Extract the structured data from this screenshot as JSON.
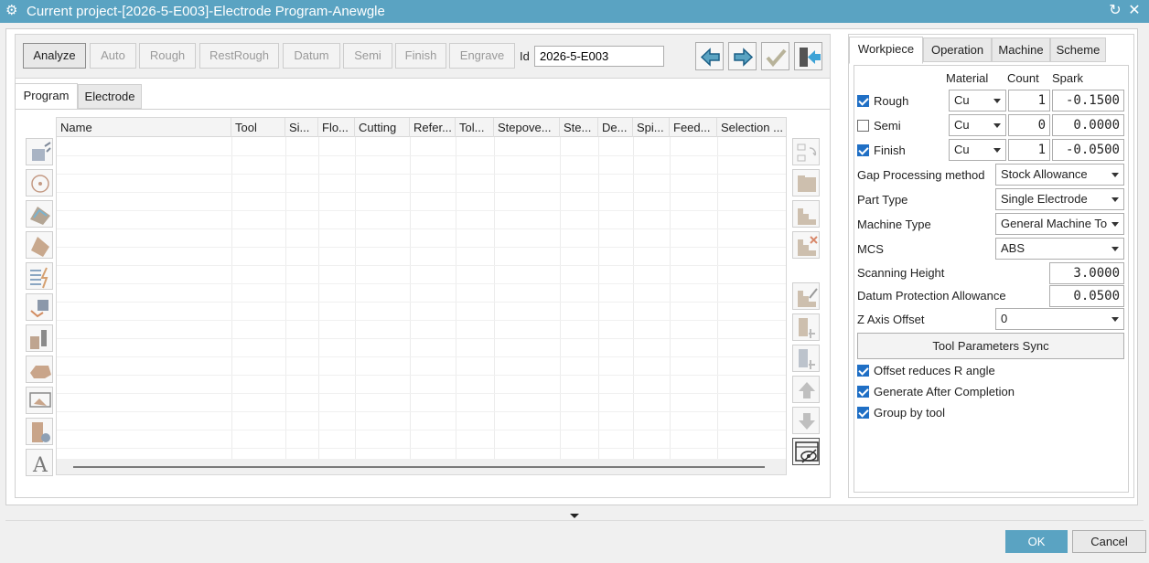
{
  "window": {
    "title": "Current project-[2026-5-E003]-Electrode Program-Anewgle",
    "gear_glyph": "⚙",
    "refresh_glyph": "↻",
    "close_glyph": "✕"
  },
  "toolbar": {
    "buttons": [
      {
        "label": "Analyze",
        "enabled": true
      },
      {
        "label": "Auto",
        "enabled": false
      },
      {
        "label": "Rough",
        "enabled": false
      },
      {
        "label": "RestRough",
        "enabled": false
      },
      {
        "label": "Datum",
        "enabled": false
      },
      {
        "label": "Semi",
        "enabled": false
      },
      {
        "label": "Finish",
        "enabled": false
      },
      {
        "label": "Engrave",
        "enabled": false
      }
    ],
    "id_label": "Id",
    "id_value": "2026-5-E003"
  },
  "left_tabs": [
    "Program",
    "Electrode"
  ],
  "table": {
    "columns": [
      "Name",
      "Tool",
      "Si...",
      "Flo...",
      "Cutting",
      "Refer...",
      "Tol...",
      "Stepove...",
      "Ste...",
      "De...",
      "Spi...",
      "Feed...",
      "Selection ..."
    ]
  },
  "right_tabs": [
    "Workpiece",
    "Operation",
    "Machine",
    "Scheme"
  ],
  "workpiece": {
    "headers": {
      "material": "Material",
      "count": "Count",
      "spark": "Spark"
    },
    "rows": [
      {
        "label": "Rough",
        "checked": true,
        "material": "Cu",
        "count": "1",
        "spark": "-0.1500"
      },
      {
        "label": "Semi",
        "checked": false,
        "material": "Cu",
        "count": "0",
        "spark": "0.0000"
      },
      {
        "label": "Finish",
        "checked": true,
        "material": "Cu",
        "count": "1",
        "spark": "-0.0500"
      }
    ],
    "gap_processing_label": "Gap Processing method",
    "gap_processing_value": "Stock Allowance",
    "part_type_label": "Part Type",
    "part_type_value": "Single Electrode",
    "machine_type_label": "Machine Type",
    "machine_type_value": "General Machine To",
    "mcs_label": "MCS",
    "mcs_value": "ABS",
    "scanning_height_label": "Scanning Height",
    "scanning_height_value": "3.0000",
    "datum_protection_label": "Datum Protection Allowance",
    "datum_protection_value": "0.0500",
    "z_offset_label": "Z Axis Offset",
    "z_offset_value": "0",
    "sync_button": "Tool Parameters Sync",
    "options": [
      {
        "label": "Offset reduces R angle",
        "checked": true
      },
      {
        "label": "Generate After Completion",
        "checked": true
      },
      {
        "label": "Group by tool",
        "checked": true
      }
    ]
  },
  "footer": {
    "ok": "OK",
    "cancel": "Cancel"
  },
  "colors": {
    "accent": "#5aa3c2",
    "check": "#1f6fc5"
  }
}
